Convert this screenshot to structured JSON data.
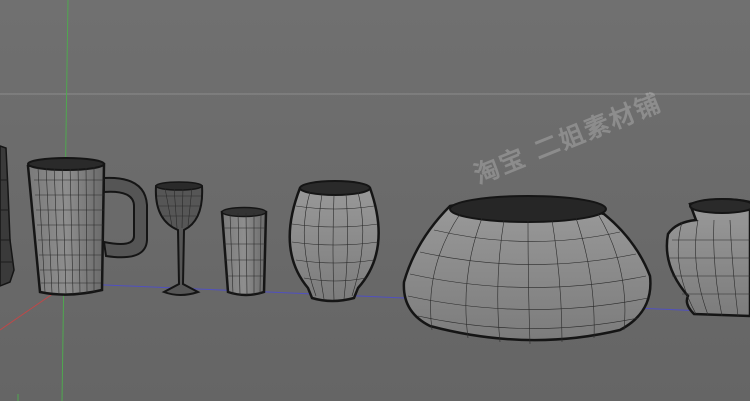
{
  "viewport": {
    "background_color": "#6e6e6e",
    "wire_color": "#1e1e1e",
    "axis_colors": {
      "x": "#c44a4a",
      "y": "#56b356",
      "z": "#5555c8"
    }
  },
  "watermark": {
    "text": "淘宝 二姐素材铺"
  },
  "objects": [
    {
      "name": "vase-partial-left"
    },
    {
      "name": "beer-mug"
    },
    {
      "name": "wine-glass"
    },
    {
      "name": "tumbler-glass"
    },
    {
      "name": "round-vase"
    },
    {
      "name": "wide-bowl"
    },
    {
      "name": "jar-vase-partial-right"
    }
  ]
}
